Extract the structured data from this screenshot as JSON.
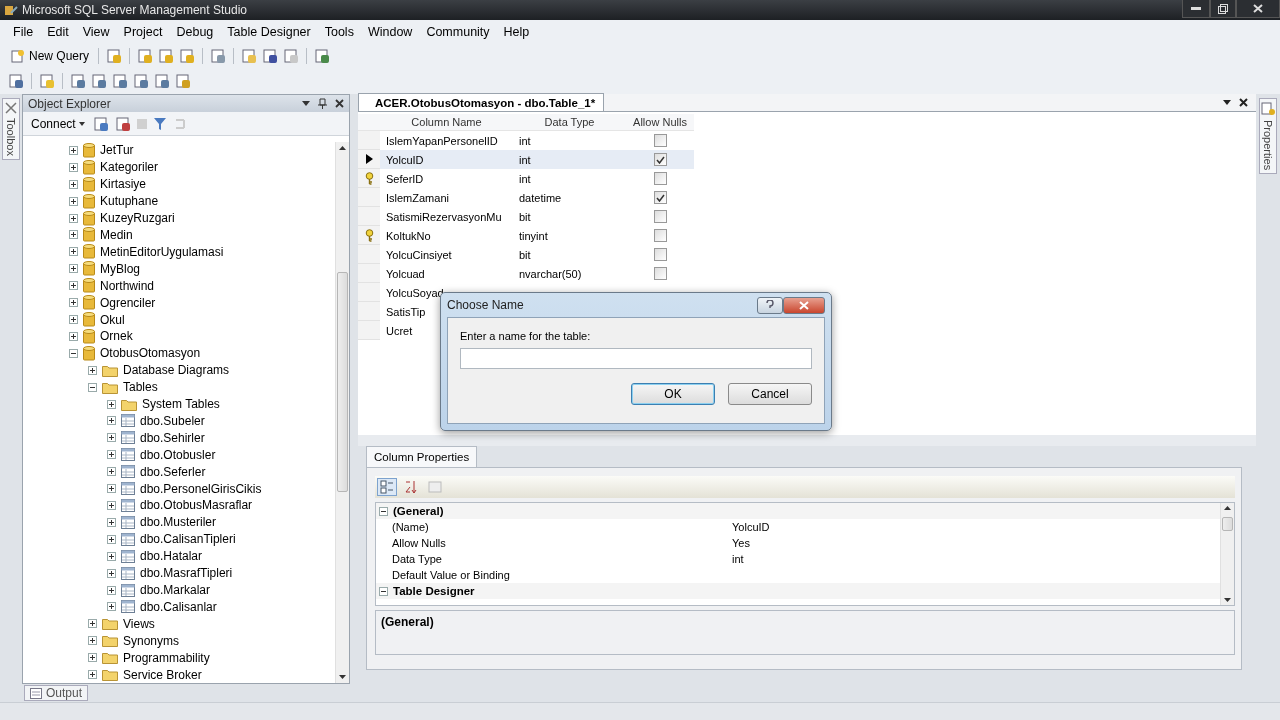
{
  "window": {
    "title": "Microsoft SQL Server Management Studio"
  },
  "menu": [
    "File",
    "Edit",
    "View",
    "Project",
    "Debug",
    "Table Designer",
    "Tools",
    "Window",
    "Community",
    "Help"
  ],
  "toolbar": {
    "new_query": "New Query"
  },
  "toolbox_tab": "Toolbox",
  "object_explorer": {
    "title": "Object Explorer",
    "connect": "Connect",
    "tree": [
      {
        "label": "JetTur",
        "kind": "database",
        "expanded": false
      },
      {
        "label": "Kategoriler",
        "kind": "database",
        "expanded": false
      },
      {
        "label": "Kirtasiye",
        "kind": "database",
        "expanded": false
      },
      {
        "label": "Kutuphane",
        "kind": "database",
        "expanded": false
      },
      {
        "label": "KuzeyRuzgari",
        "kind": "database",
        "expanded": false
      },
      {
        "label": "Medin",
        "kind": "database",
        "expanded": false
      },
      {
        "label": "MetinEditorUygulamasi",
        "kind": "database",
        "expanded": false
      },
      {
        "label": "MyBlog",
        "kind": "database",
        "expanded": false
      },
      {
        "label": "Northwind",
        "kind": "database",
        "expanded": false
      },
      {
        "label": "Ogrenciler",
        "kind": "database",
        "expanded": false
      },
      {
        "label": "Okul",
        "kind": "database",
        "expanded": false
      },
      {
        "label": "Ornek",
        "kind": "database",
        "expanded": false
      },
      {
        "label": "OtobusOtomasyon",
        "kind": "database",
        "expanded": true,
        "children": [
          {
            "label": "Database Diagrams",
            "kind": "folder",
            "expanded": false
          },
          {
            "label": "Tables",
            "kind": "folder",
            "expanded": true,
            "children": [
              {
                "label": "System Tables",
                "kind": "folder",
                "expanded": false
              },
              {
                "label": "dbo.Subeler",
                "kind": "table",
                "expanded": false
              },
              {
                "label": "dbo.Sehirler",
                "kind": "table",
                "expanded": false
              },
              {
                "label": "dbo.Otobusler",
                "kind": "table",
                "expanded": false
              },
              {
                "label": "dbo.Seferler",
                "kind": "table",
                "expanded": false
              },
              {
                "label": "dbo.PersonelGirisCikis",
                "kind": "table",
                "expanded": false
              },
              {
                "label": "dbo.OtobusMasraflar",
                "kind": "table",
                "expanded": false
              },
              {
                "label": "dbo.Musteriler",
                "kind": "table",
                "expanded": false
              },
              {
                "label": "dbo.CalisanTipleri",
                "kind": "table",
                "expanded": false
              },
              {
                "label": "dbo.Hatalar",
                "kind": "table",
                "expanded": false
              },
              {
                "label": "dbo.MasrafTipleri",
                "kind": "table",
                "expanded": false
              },
              {
                "label": "dbo.Markalar",
                "kind": "table",
                "expanded": false
              },
              {
                "label": "dbo.Calisanlar",
                "kind": "table",
                "expanded": false
              }
            ]
          },
          {
            "label": "Views",
            "kind": "folder",
            "expanded": false
          },
          {
            "label": "Synonyms",
            "kind": "folder",
            "expanded": false
          },
          {
            "label": "Programmability",
            "kind": "folder",
            "expanded": false
          },
          {
            "label": "Service Broker",
            "kind": "folder",
            "expanded": false
          }
        ]
      }
    ]
  },
  "document": {
    "tab": "ACER.OtobusOtomasyon - dbo.Table_1*",
    "columns": [
      "Column Name",
      "Data Type",
      "Allow Nulls"
    ],
    "rows": [
      {
        "name": "IslemYapanPersonelID",
        "data_type": "int",
        "allow_nulls": false,
        "selected": false,
        "primary_key": false
      },
      {
        "name": "YolcuID",
        "data_type": "int",
        "allow_nulls": true,
        "selected": true,
        "primary_key": false
      },
      {
        "name": "SeferID",
        "data_type": "int",
        "allow_nulls": false,
        "selected": false,
        "primary_key": true
      },
      {
        "name": "IslemZamani",
        "data_type": "datetime",
        "allow_nulls": true,
        "selected": false,
        "primary_key": false
      },
      {
        "name": "SatismiRezervasyonMu",
        "data_type": "bit",
        "allow_nulls": false,
        "selected": false,
        "primary_key": false
      },
      {
        "name": "KoltukNo",
        "data_type": "tinyint",
        "allow_nulls": false,
        "selected": false,
        "primary_key": true
      },
      {
        "name": "YolcuCinsiyet",
        "data_type": "bit",
        "allow_nulls": false,
        "selected": false,
        "primary_key": false
      },
      {
        "name": "Yolcuad",
        "data_type": "nvarchar(50)",
        "allow_nulls": false,
        "selected": false,
        "primary_key": false
      },
      {
        "name": "YolcuSoyad",
        "selected": false,
        "primary_key": false
      },
      {
        "name": "SatisTip",
        "selected": false,
        "primary_key": false
      },
      {
        "name": "Ucret",
        "selected": false,
        "primary_key": false
      }
    ]
  },
  "column_properties": {
    "tab": "Column Properties",
    "sections": [
      {
        "title": "(General)",
        "expanded": true,
        "rows": [
          {
            "name": "(Name)",
            "value": "YolcuID"
          },
          {
            "name": "Allow Nulls",
            "value": "Yes"
          },
          {
            "name": "Data Type",
            "value": "int"
          },
          {
            "name": "Default Value or Binding"
          }
        ]
      },
      {
        "title": "Table Designer",
        "expanded": true
      }
    ],
    "description": "(General)"
  },
  "properties_tab": "Properties",
  "output_tab": "Output",
  "dialog": {
    "title": "Choose Name",
    "prompt": "Enter a name for the table:",
    "buttons": [
      {
        "label": "OK",
        "default": true
      },
      {
        "label": "Cancel",
        "default": false
      }
    ]
  }
}
